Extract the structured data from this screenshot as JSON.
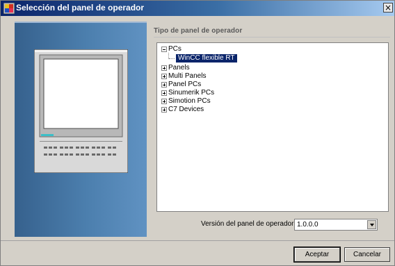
{
  "window": {
    "title": "Selección del panel de operador",
    "close_glyph": "×",
    "icon": "app-icon"
  },
  "group": {
    "label": "Tipo de panel de operador"
  },
  "tree": {
    "items": [
      {
        "label": "PCs",
        "expanded": true
      },
      {
        "label": "Panels",
        "expanded": false
      },
      {
        "label": "Multi Panels",
        "expanded": false
      },
      {
        "label": "Panel PCs",
        "expanded": false
      },
      {
        "label": "Sinumerik PCs",
        "expanded": false
      },
      {
        "label": "Simotion PCs",
        "expanded": false
      },
      {
        "label": "C7 Devices",
        "expanded": false
      }
    ],
    "selected_child": "WinCC flexible RT"
  },
  "version": {
    "label": "Versión del panel de operador",
    "value": "1.0.0.0"
  },
  "buttons": {
    "ok": "Aceptar",
    "cancel": "Cancelar"
  },
  "colors": {
    "title_gradient_start": "#0a246a",
    "selection": "#0a246a",
    "side_panel": "#4c7fae"
  }
}
